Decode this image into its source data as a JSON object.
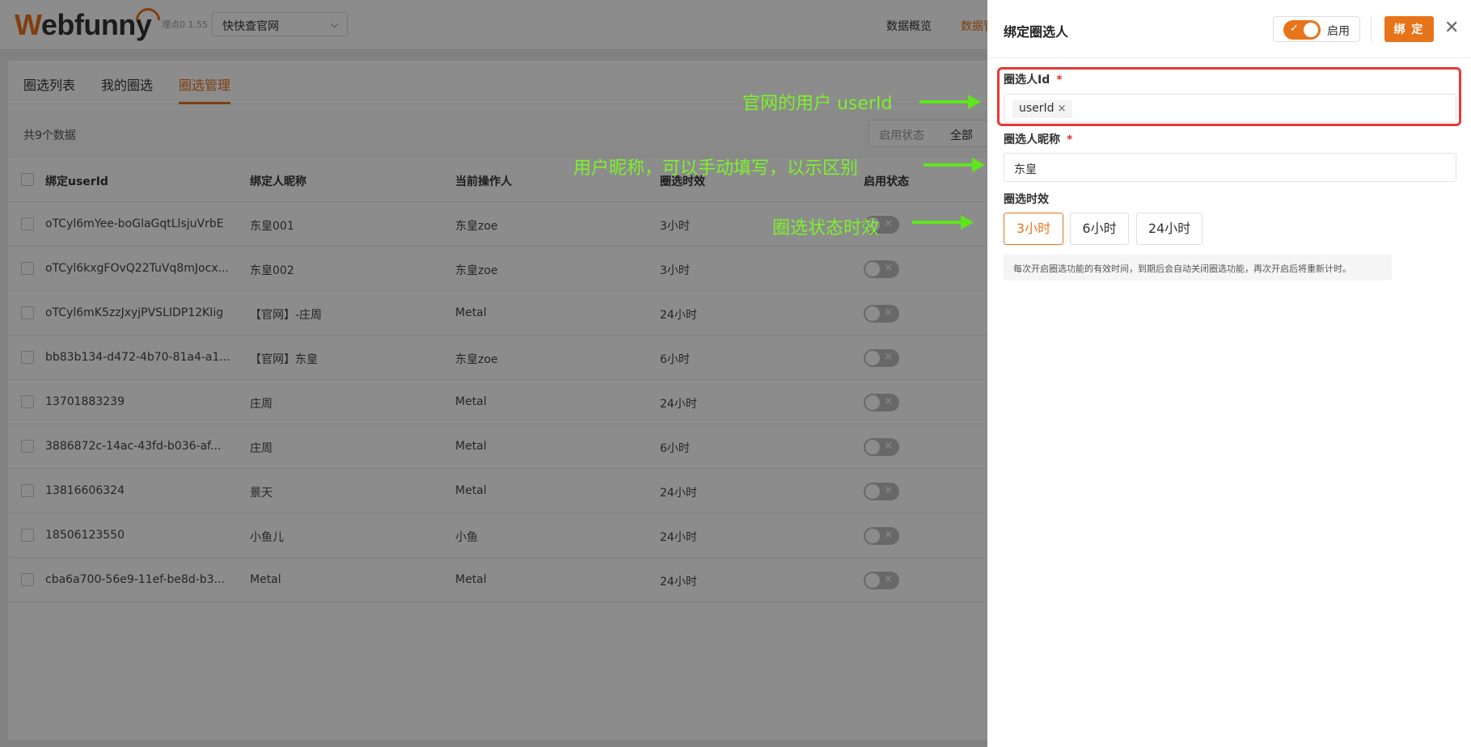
{
  "header": {
    "logo": "Webfunny",
    "version": "埋点0.1.55",
    "project": "快快查官网",
    "nav": [
      "数据概览",
      "数据管"
    ]
  },
  "tabs": [
    "圈选列表",
    "我的圈选",
    "圈选管理"
  ],
  "list": {
    "count_text": "共9个数据",
    "filter_label": "启用状态",
    "filter_value": "全部",
    "columns": [
      "绑定userId",
      "绑定人昵称",
      "当前操作人",
      "圈选时效",
      "启用状态"
    ],
    "rows": [
      {
        "userId": "oTCyl6mYee-boGlaGqtLlsjuVrbE",
        "nick": "东皇001",
        "operator": "东皇zoe",
        "duration": "3小时"
      },
      {
        "userId": "oTCyl6kxgFOvQ22TuVq8mJocx...",
        "nick": "东皇002",
        "operator": "东皇zoe",
        "duration": "3小时"
      },
      {
        "userId": "oTCyl6mK5zzJxyjPVSLIDP12KIig",
        "nick": "【官网】-庄周",
        "operator": "Metal",
        "duration": "24小时"
      },
      {
        "userId": "bb83b134-d472-4b70-81a4-a1...",
        "nick": "【官网】东皇",
        "operator": "东皇zoe",
        "duration": "6小时"
      },
      {
        "userId": "13701883239",
        "nick": "庄周",
        "operator": "Metal",
        "duration": "24小时"
      },
      {
        "userId": "3886872c-14ac-43fd-b036-af...",
        "nick": "庄周",
        "operator": "Metal",
        "duration": "6小时"
      },
      {
        "userId": "13816606324",
        "nick": "景天",
        "operator": "Metal",
        "duration": "24小时"
      },
      {
        "userId": "18506123550",
        "nick": "小鱼儿",
        "operator": "小鱼",
        "duration": "24小时"
      },
      {
        "userId": "cba6a700-56e9-11ef-be8d-b3...",
        "nick": "Metal",
        "operator": "Metal",
        "duration": "24小时"
      }
    ]
  },
  "annotations": [
    "官网的用户 userId",
    "用户昵称，可以手动填写，以示区别",
    "圈选状态时效"
  ],
  "drawer": {
    "title": "绑定圈选人",
    "switch_label": "启用",
    "bind_button": "绑 定",
    "id_label": "圈选人Id",
    "id_tag": "userId",
    "nick_label": "圈选人昵称",
    "nick_value": "东皇",
    "duration_label": "圈选时效",
    "duration_options": [
      "3小时",
      "6小时",
      "24小时"
    ],
    "duration_selected": "3小时",
    "hint": "每次开启圈选功能的有效时间，到期后会自动关闭圈选功能，再次开启后将重新计时。"
  },
  "colors": {
    "accent": "#e8741a",
    "annotation": "#7cf22a",
    "highlight": "#e53935"
  }
}
